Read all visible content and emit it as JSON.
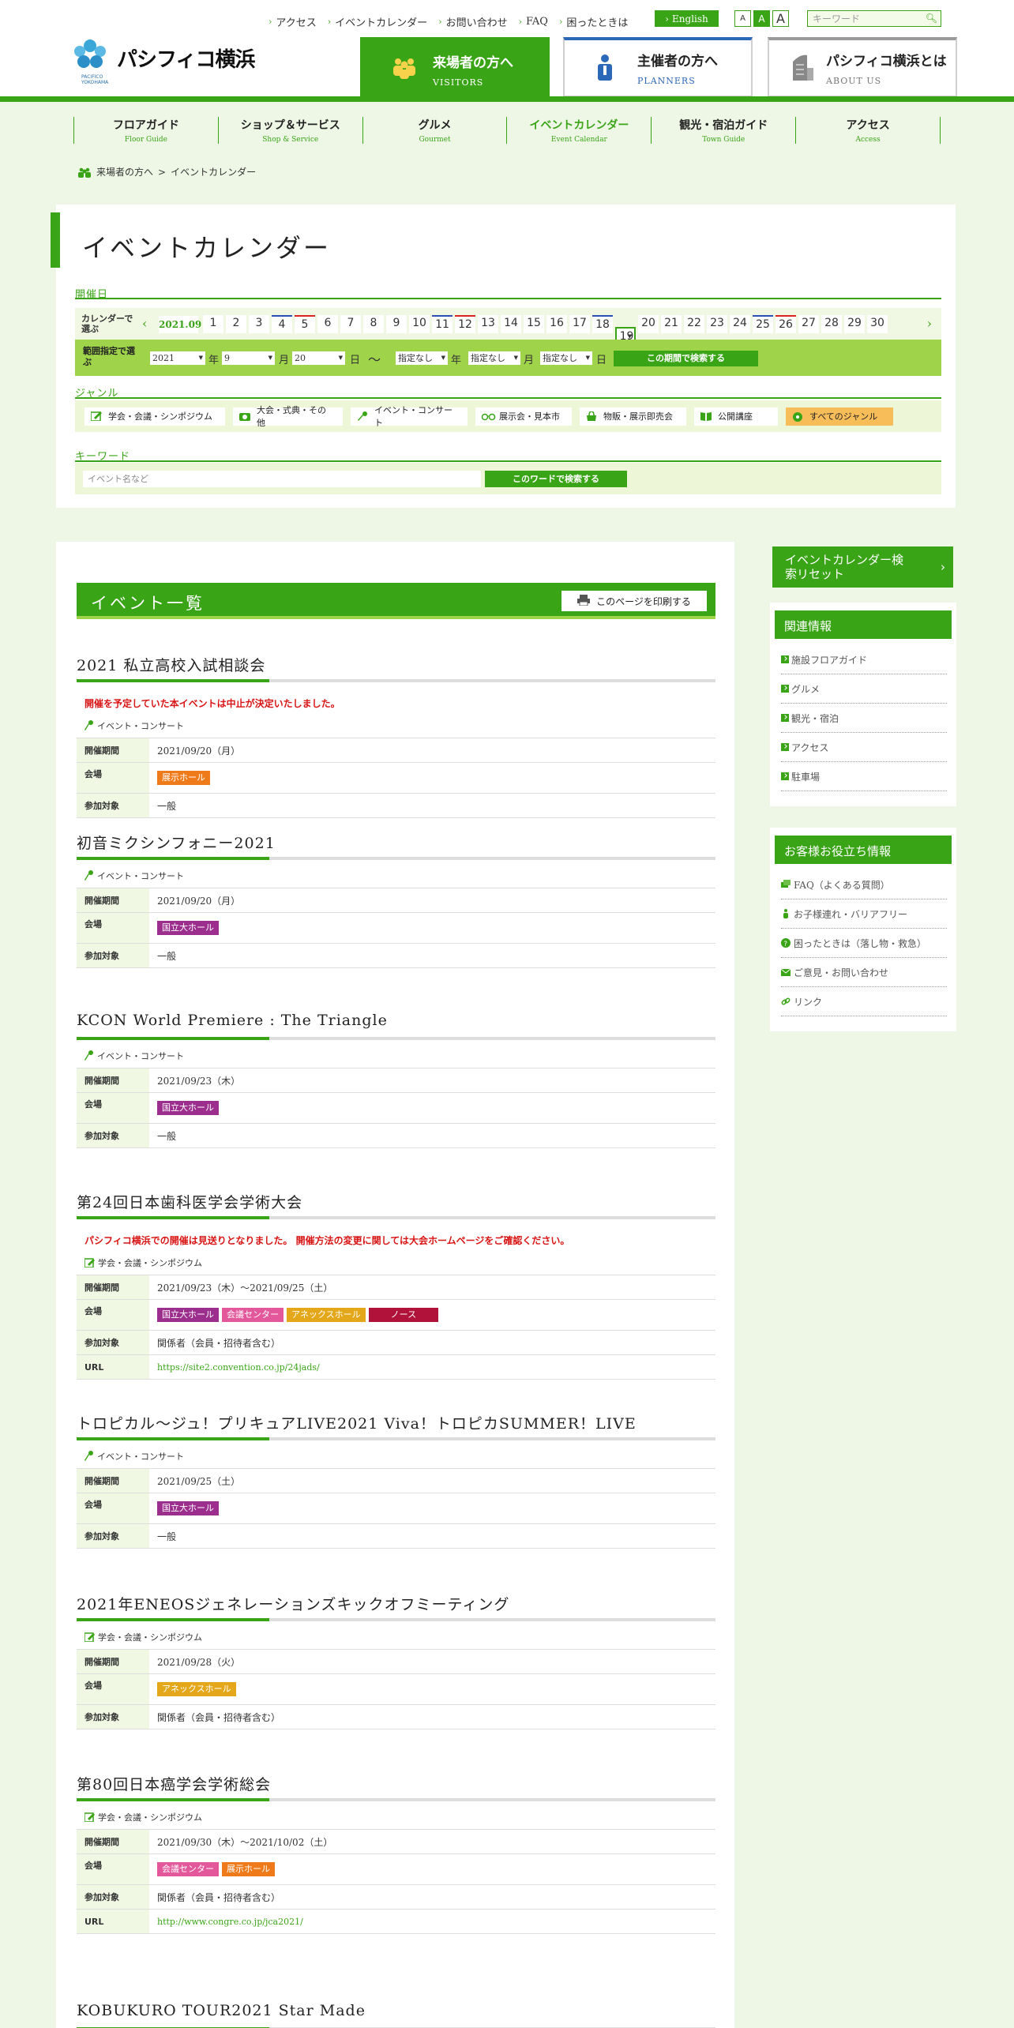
{
  "header": {
    "top_links": [
      "アクセス",
      "イベントカレンダー",
      "お問い合わせ",
      "FAQ",
      "困ったときは"
    ],
    "english_label": "English",
    "font_sizes": [
      "A",
      "A",
      "A"
    ],
    "search_placeholder": "キーワード",
    "logo_text": "パシフィコ横浜",
    "logo_sub": "PACIFICO YOKOHAMA",
    "tabs": [
      {
        "title": "来場者の方へ",
        "sub": "VISITORS"
      },
      {
        "title": "主催者の方へ",
        "sub": "PLANNERS"
      },
      {
        "title": "パシフィコ横浜とは",
        "sub": "ABOUT US"
      }
    ],
    "accent": "#3aa417"
  },
  "gnav": [
    {
      "ja": "フロアガイド",
      "en": "Floor Guide"
    },
    {
      "ja": "ショップ＆サービス",
      "en": "Shop & Service"
    },
    {
      "ja": "グルメ",
      "en": "Gourmet"
    },
    {
      "ja": "イベントカレンダー",
      "en": "Event Calendar"
    },
    {
      "ja": "観光・宿泊ガイド",
      "en": "Town Guide"
    },
    {
      "ja": "アクセス",
      "en": "Access"
    }
  ],
  "breadcrumb": [
    "来場者の方へ",
    ">",
    "イベントカレンダー"
  ],
  "calendar": {
    "title": "イベントカレンダー",
    "date_label": "開催日",
    "cal_select_label": "カレンダーで選ぶ",
    "month": "2021.09",
    "days": [
      "1",
      "2",
      "3",
      "4",
      "5",
      "6",
      "7",
      "8",
      "9",
      "10",
      "11",
      "12",
      "13",
      "14",
      "15",
      "16",
      "17",
      "18",
      "19",
      "20",
      "21",
      "22",
      "23",
      "24",
      "25",
      "26",
      "27",
      "28",
      "29",
      "30"
    ],
    "range_label": "範囲指定で選ぶ",
    "range": {
      "year": "2021",
      "month": "9",
      "day": "20",
      "y": "年",
      "m": "月",
      "d": "日",
      "tilde": "〜",
      "none": "指定なし"
    },
    "range_button": "この期間で検索する",
    "genre_label": "ジャンル",
    "genres": [
      "学会・会議・シンポジウム",
      "大会・式典・その他",
      "イベント・コンサート",
      "展示会・見本市",
      "物販・展示即売会",
      "公開講座",
      "すべてのジャンル"
    ],
    "keyword_label": "キーワード",
    "keyword_placeholder": "イベント名など",
    "keyword_button": "このワードで検索する"
  },
  "list": {
    "title": "イベント一覧",
    "print": "このページを印刷する",
    "labels": {
      "period": "開催期間",
      "venue": "会場",
      "audience": "参加対象",
      "url": "URL"
    },
    "events": [
      {
        "title": "2021 私立高校入試相談会",
        "note": "開催を予定していた本イベントは中止が決定いたしました。",
        "genre": "イベント・コンサート",
        "period": "2021/09/20（月）",
        "venues": [
          {
            "name": "展示ホール",
            "cls": "v-ten"
          }
        ],
        "audience": "一般"
      },
      {
        "title": "初音ミクシンフォニー2021",
        "genre": "イベント・コンサート",
        "period": "2021/09/20（月）",
        "venues": [
          {
            "name": "国立大ホール",
            "cls": "v-kok"
          }
        ],
        "audience": "一般"
      },
      {
        "title": "KCON World Premiere : The Triangle",
        "genre": "イベント・コンサート",
        "period": "2021/09/23（木）",
        "venues": [
          {
            "name": "国立大ホール",
            "cls": "v-kok"
          }
        ],
        "audience": "一般"
      },
      {
        "title": "第24回日本歯科医学会学術大会",
        "note": "パシフィコ横浜での開催は見送りとなりました。 開催方法の変更に関しては大会ホームページをご確認ください。",
        "genre": "学会・会議・シンポジウム",
        "period": "2021/09/23（木）～2021/09/25（土）",
        "venues": [
          {
            "name": "国立大ホール",
            "cls": "v-kok"
          },
          {
            "name": "会議センター",
            "cls": "v-kai"
          },
          {
            "name": "アネックスホール",
            "cls": "v-ann"
          },
          {
            "name": "ノース",
            "cls": "v-nor"
          }
        ],
        "audience": "関係者（会員・招待者含む）",
        "url": "https://site2.convention.co.jp/24jads/"
      },
      {
        "title": "トロピカル～ジュ！プリキュアLIVE2021 Viva！トロピカSUMMER！LIVE",
        "genre": "イベント・コンサート",
        "period": "2021/09/25（土）",
        "venues": [
          {
            "name": "国立大ホール",
            "cls": "v-kok"
          }
        ],
        "audience": "一般"
      },
      {
        "title": "2021年ENEOSジェネレーションズキックオフミーティング",
        "genre": "学会・会議・シンポジウム",
        "period": "2021/09/28（火）",
        "venues": [
          {
            "name": "アネックスホール",
            "cls": "v-ann"
          }
        ],
        "audience": "関係者（会員・招待者含む）"
      },
      {
        "title": "第80回日本癌学会学術総会",
        "genre": "学会・会議・シンポジウム",
        "period": "2021/09/30（木）～2021/10/02（土）",
        "venues": [
          {
            "name": "会議センター",
            "cls": "v-kai"
          },
          {
            "name": "展示ホール",
            "cls": "v-ten"
          }
        ],
        "audience": "関係者（会員・招待者含む）",
        "url": "http://www.congre.co.jp/jca2021/"
      },
      {
        "title": "KOBUKURO TOUR2021 Star Made"
      }
    ]
  },
  "side": {
    "reset": "イベントカレンダー検索リセット",
    "related_title": "関連情報",
    "related": [
      "施設フロアガイド",
      "グルメ",
      "観光・宿泊",
      "アクセス",
      "駐車場"
    ],
    "help_title": "お客様お役立ち情報",
    "help": [
      "FAQ（よくある質問）",
      "お子様連れ・バリアフリー",
      "困ったときは（落し物・救急）",
      "ご意見・お問い合わせ",
      "リンク"
    ]
  }
}
